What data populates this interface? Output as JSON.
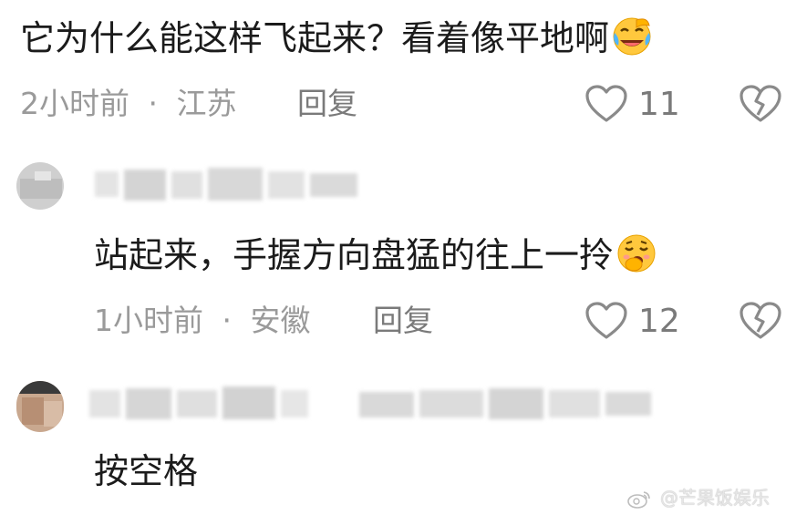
{
  "comments": [
    {
      "text": "它为什么能这样飞起来？看着像平地啊",
      "emoji_icon": "laughing-crying-face-icon",
      "time": "2小时前",
      "separator": "·",
      "location": "江苏",
      "reply_label": "回复",
      "likes": "11"
    },
    {
      "username_blurred": true,
      "text": "站起来，手握方向盘猛的往上一拎",
      "emoji_icon": "yawning-face-icon",
      "time": "1小时前",
      "separator": "·",
      "location": "安徽",
      "reply_label": "回复",
      "likes": "12"
    },
    {
      "username_blurred": true,
      "text": "按空格"
    }
  ],
  "watermark": {
    "logo": "weibo-logo-icon",
    "text": "@芒果饭娱乐"
  },
  "colors": {
    "text": "#1b1b1b",
    "meta": "#9a9a9a",
    "action": "#7a7a7a",
    "emoji_yellow": "#ffc83d"
  }
}
